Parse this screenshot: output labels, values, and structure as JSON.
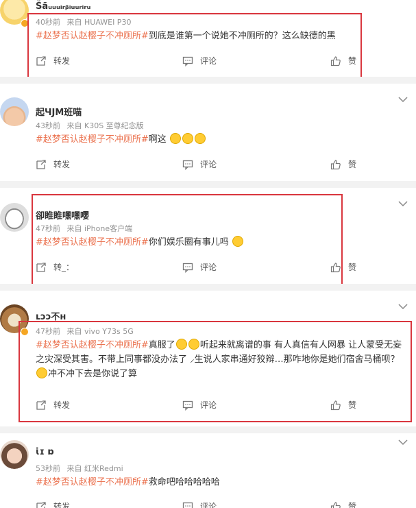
{
  "actions": {
    "repost": "转发",
    "comment": "评论",
    "like": "赞"
  },
  "posts": [
    {
      "username": "Šãᵤᵤᵤᵢᵣᵦᵢᵤᵤᵣᵢᵣᵤ",
      "time": "40秒前",
      "source": "来自 HUAWEI P30",
      "hashtag": "#赵梦否认赵樱子不冲厕所#",
      "text": "到底是谁第一个说她不冲厕所的？这么缺德的黑",
      "repost_label": "转发"
    },
    {
      "username": "起ꞍЈМ班喵",
      "time": "43秒前",
      "source": "来自 K30S 至尊纪念版",
      "hashtag": "#赵梦否认赵樱子不冲厕所#",
      "text": "啊这",
      "repost_label": "转发"
    },
    {
      "username": "卻睢睢嘿嘿嘤",
      "time": "47秒前",
      "source": "来自 iPhone客户端",
      "hashtag": "#赵梦否认赵樱子不冲厕所#",
      "text": "你们娱乐圈有事儿吗",
      "repost_label": "转_："
    },
    {
      "username": "ʟɔɔ不ʜ",
      "time": "47秒前",
      "source": "来自 vivo Y73s 5G",
      "hashtag": "#赵梦否认赵樱子不冲厕所#",
      "text_1": "真服了",
      "text_2": "听起来就离谱的事 有人真信有人网暴 让人蒙受无妄之灾深受其害。不带上同事都没办法了 ⸝生说人家串通好狡辩…那咋地你是她们宿舍马桶呗？",
      "text_3": "冲不冲下去是你说了算",
      "repost_label": "转发"
    },
    {
      "username": "ɩ̇ɪ ɒ",
      "time": "53秒前",
      "source": "来自 红米Redmi",
      "hashtag": "#赵梦否认赵樱子不冲厕所#",
      "text": "救命吧哈哈哈哈哈",
      "repost_label": "转发"
    }
  ]
}
